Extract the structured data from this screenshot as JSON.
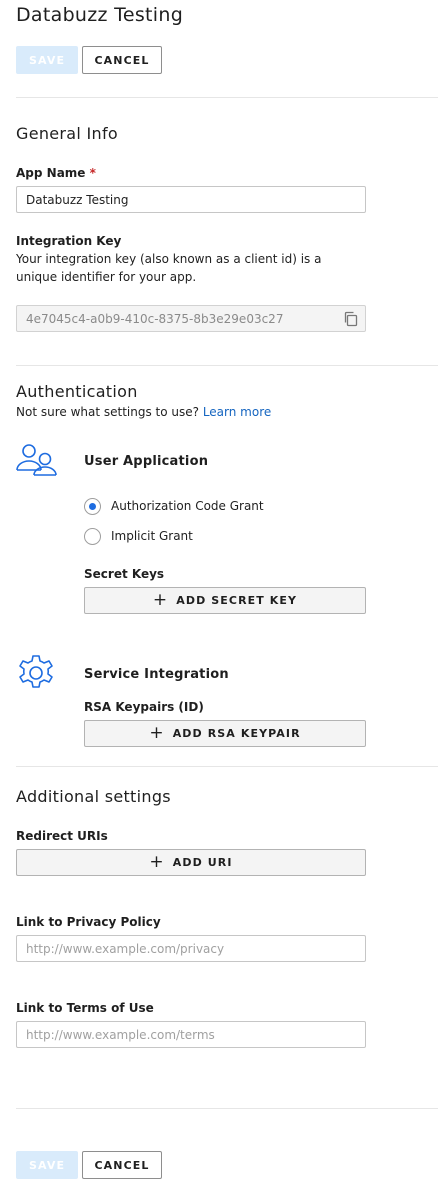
{
  "page": {
    "title": "Databuzz Testing"
  },
  "actions": {
    "save_label": "SAVE",
    "cancel_label": "CANCEL"
  },
  "general": {
    "heading": "General Info",
    "app_name": {
      "label": "App Name",
      "required_mark": "*",
      "value": "Databuzz Testing"
    },
    "integration_key": {
      "label": "Integration Key",
      "description": "Your integration key (also known as a client id) is a unique identifier for your app.",
      "value": "4e7045c4-a0b9-410c-8375-8b3e29e03c27"
    }
  },
  "authentication": {
    "heading": "Authentication",
    "help_text": "Not sure what settings to use?",
    "help_link": "Learn more",
    "user_application": {
      "heading": "User Application",
      "icon": "users-icon",
      "grant_options": [
        {
          "label": "Authorization Code Grant",
          "selected": true
        },
        {
          "label": "Implicit Grant",
          "selected": false
        }
      ],
      "secret_keys_label": "Secret Keys",
      "add_secret_key_label": "ADD SECRET KEY"
    },
    "service_integration": {
      "heading": "Service Integration",
      "icon": "gear-icon",
      "rsa_label": "RSA Keypairs (ID)",
      "add_rsa_label": "ADD RSA KEYPAIR"
    }
  },
  "additional": {
    "heading": "Additional settings",
    "redirect_uris_label": "Redirect URIs",
    "add_uri_label": "ADD URI",
    "privacy": {
      "label": "Link to Privacy Policy",
      "placeholder": "http://www.example.com/privacy"
    },
    "terms": {
      "label": "Link to Terms of Use",
      "placeholder": "http://www.example.com/terms"
    }
  },
  "colors": {
    "accent": "#1e6ce0",
    "link": "#1565c0",
    "save_disabled": "#d9ebfb",
    "required": "#c62828"
  }
}
